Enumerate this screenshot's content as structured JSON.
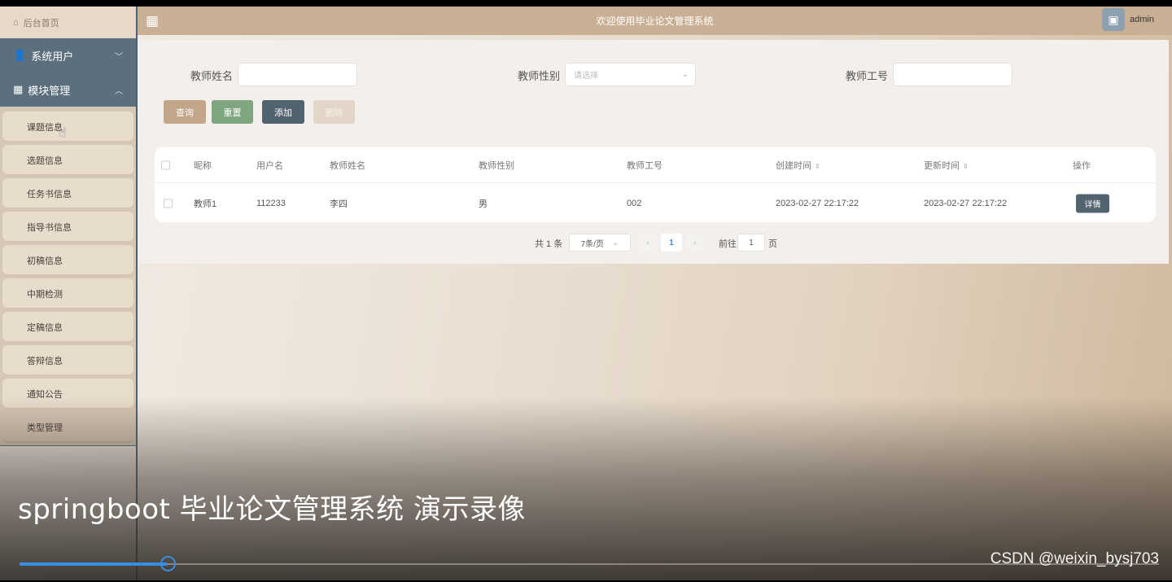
{
  "sidebar": {
    "home": "后台首页",
    "groups": [
      {
        "label": "系统用户",
        "chevron": "﹀"
      },
      {
        "label": "模块管理",
        "chevron": "︿"
      }
    ],
    "items": [
      "课题信息",
      "选题信息",
      "任务书信息",
      "指导书信息",
      "初稿信息",
      "中期检测",
      "定稿信息",
      "答辩信息",
      "通知公告",
      "类型管理"
    ]
  },
  "header": {
    "title": "欢迎使用毕业论文管理系统",
    "user": "admin"
  },
  "filters": {
    "teacher_name_label": "教师姓名",
    "teacher_name_value": "",
    "gender_label": "教师性别",
    "gender_placeholder": "请选择",
    "teacher_no_label": "教师工号",
    "teacher_no_value": ""
  },
  "buttons": {
    "query": "查询",
    "reset": "重置",
    "add": "添加",
    "delete": "删除"
  },
  "table": {
    "columns": [
      "昵称",
      "用户名",
      "教师姓名",
      "教师性别",
      "教师工号",
      "创建时间",
      "更新时间",
      "操作"
    ],
    "rows": [
      {
        "nickname": "教师1",
        "username": "112233",
        "name": "李四",
        "gender": "男",
        "no": "002",
        "created": "2023-02-27 22:17:22",
        "updated": "2023-02-27 22:17:22",
        "action": "详情"
      }
    ]
  },
  "pagination": {
    "total": "共 1 条",
    "page_size": "7条/页",
    "current": "1",
    "goto_label": "前往",
    "goto_value": "1",
    "page_suffix": "页"
  },
  "overlay": {
    "caption": "springboot 毕业论文管理系统 演示录像",
    "watermark": "CSDN @weixin_bysj703",
    "progress": 0.13,
    "accent": "#3a8de0"
  },
  "colors": {
    "sidebar": "#5b6f7c",
    "topbar": "#c9b095",
    "query_btn": "#c2a68a",
    "reset_btn": "#7fa67f",
    "add_btn": "#51636f",
    "delete_btn": "#e3d6c8"
  }
}
